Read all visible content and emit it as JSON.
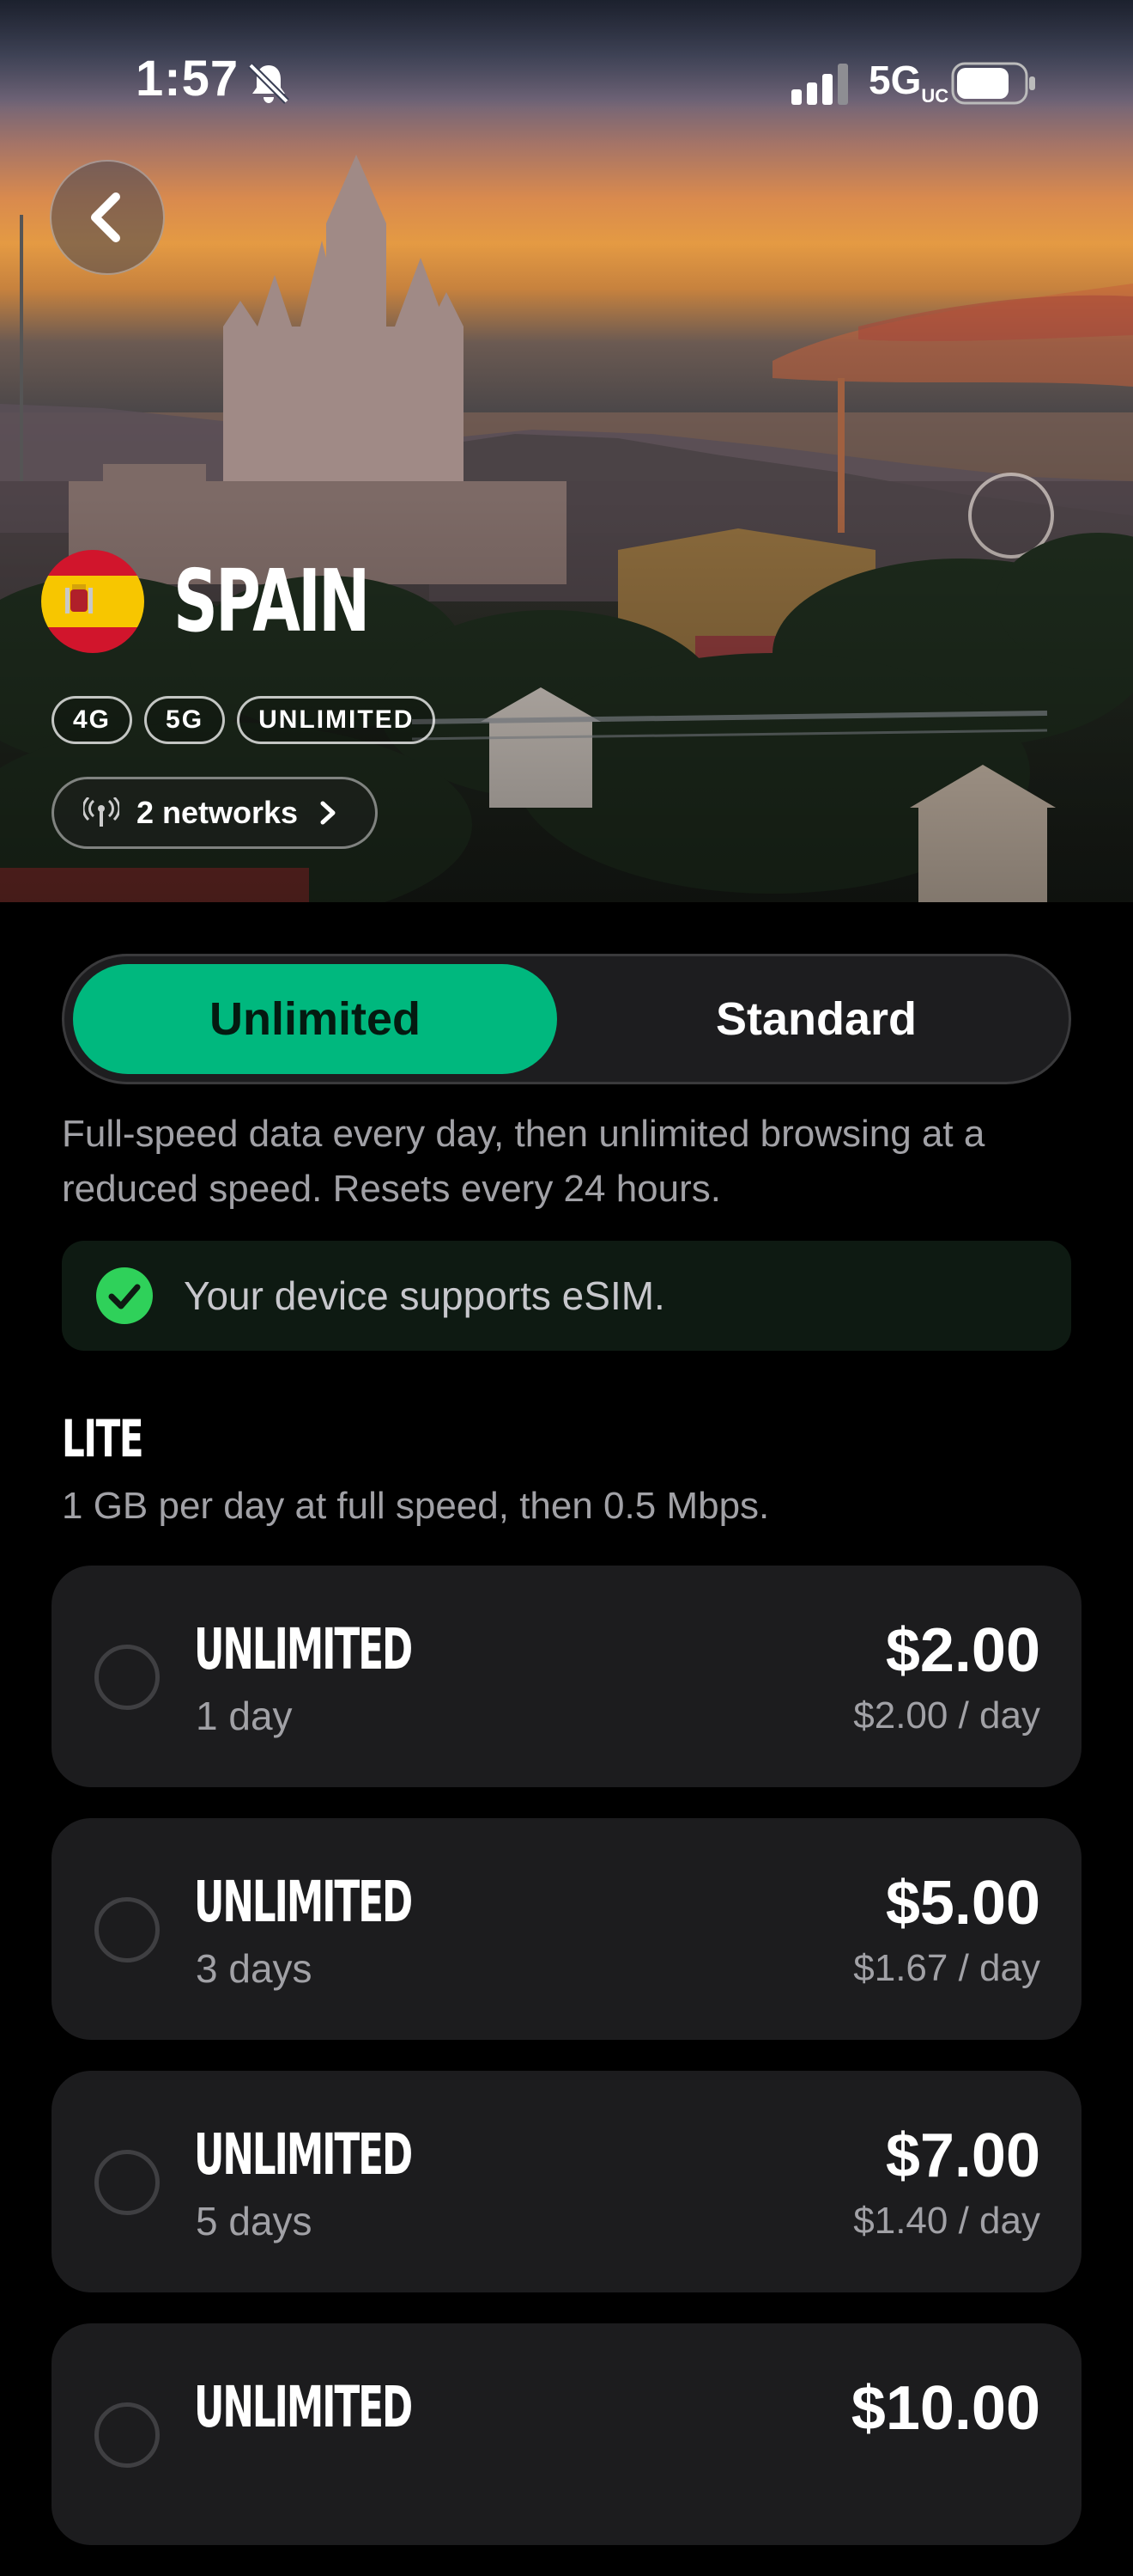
{
  "status_bar": {
    "time": "1:57",
    "network": "5G",
    "network_suffix": "UC",
    "icons": [
      "bell-slash-icon",
      "signal-icon",
      "battery-icon"
    ]
  },
  "header": {
    "back_icon": "chevron-left-icon",
    "country": "SPAIN",
    "flag": "spain-flag-icon",
    "tags": [
      "4G",
      "5G",
      "UNLIMITED"
    ],
    "networks_label": "2 networks"
  },
  "plan_type_toggle": {
    "options": [
      "Unlimited",
      "Standard"
    ],
    "selected": "Unlimited"
  },
  "description": "Full-speed data every day, then unlimited browsing at a reduced speed. Resets every 24 hours.",
  "esim_notice": "Your device supports eSIM.",
  "section": {
    "title": "LITE",
    "subtitle": "1 GB per day at full speed, then 0.5 Mbps."
  },
  "plans": [
    {
      "name": "UNLIMITED",
      "duration": "1 day",
      "price": "$2.00",
      "per_day": "$2.00 / day"
    },
    {
      "name": "UNLIMITED",
      "duration": "3 days",
      "price": "$5.00",
      "per_day": "$1.67 / day"
    },
    {
      "name": "UNLIMITED",
      "duration": "5 days",
      "price": "$7.00",
      "per_day": "$1.40 / day"
    },
    {
      "name": "UNLIMITED",
      "duration": "",
      "price": "$10.00",
      "per_day": ""
    }
  ],
  "colors": {
    "accent": "#00b87e",
    "background": "#000000",
    "card": "#1c1c1e",
    "secondary_text": "#a1a1a6"
  }
}
